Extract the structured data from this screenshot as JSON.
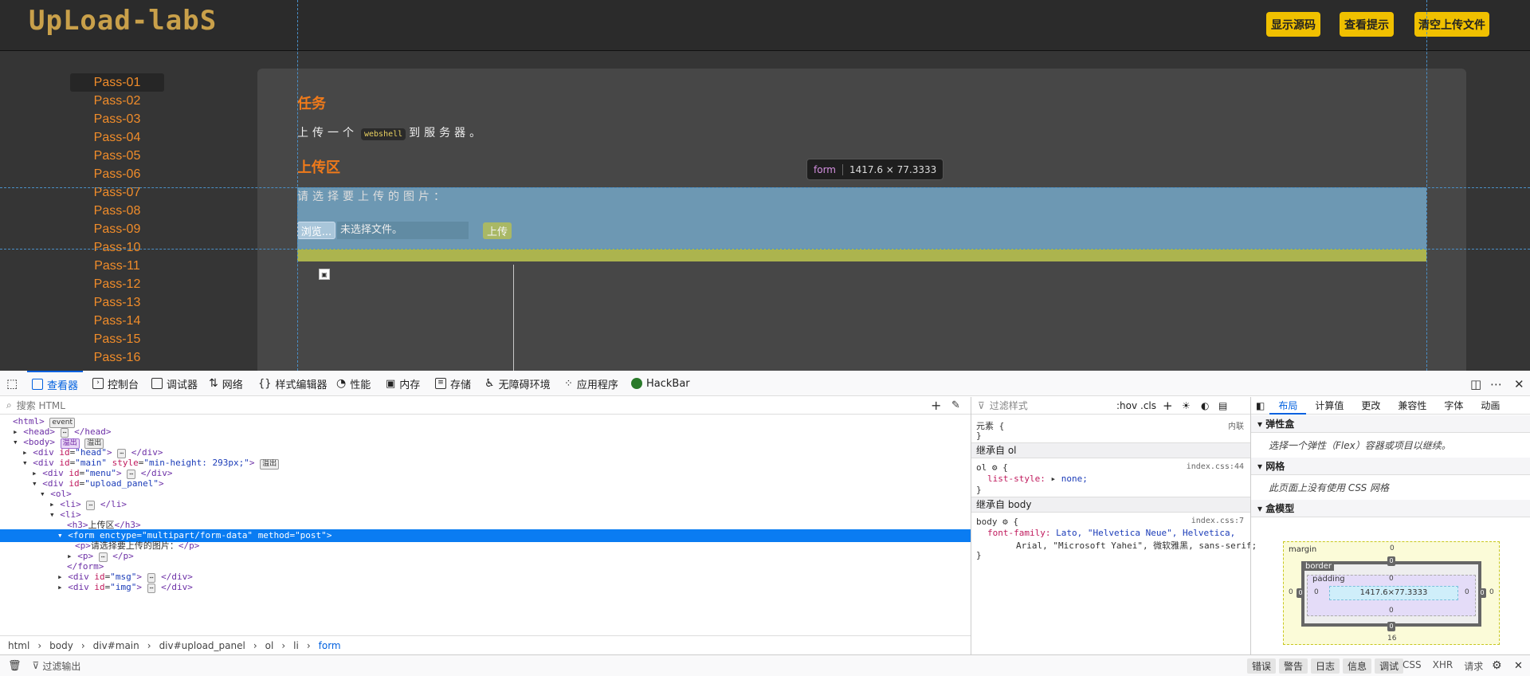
{
  "page": {
    "logo": "UpLoad-labS",
    "buttons": [
      "显示源码",
      "查看提示",
      "清空上传文件"
    ],
    "menu": [
      "Pass-01",
      "Pass-02",
      "Pass-03",
      "Pass-04",
      "Pass-05",
      "Pass-06",
      "Pass-07",
      "Pass-08",
      "Pass-09",
      "Pass-10",
      "Pass-11",
      "Pass-12",
      "Pass-13",
      "Pass-14",
      "Pass-15",
      "Pass-16"
    ],
    "task_heading": "任务",
    "task_text_before": "上传一个",
    "task_code": "webshell",
    "task_text_after": "到服务器。",
    "upload_heading": "上传区",
    "upload_label": "请选择要上传的图片：",
    "browse_label": "浏览...",
    "no_file": "未选择文件。",
    "upload_button": "上传"
  },
  "inspector_tooltip": {
    "tag": "form",
    "size": "1417.6 × 77.3333"
  },
  "devtools": {
    "tabs": [
      "查看器",
      "控制台",
      "调试器",
      "网络",
      "样式编辑器",
      "性能",
      "内存",
      "存储",
      "无障碍环境",
      "应用程序",
      "HackBar"
    ],
    "search_placeholder": "搜索 HTML",
    "breadcrumb": [
      "html",
      "body",
      "div#main",
      "div#upload_panel",
      "ol",
      "li",
      "form"
    ],
    "filter_output_placeholder": "过滤输出",
    "console_filters": [
      "错误",
      "警告",
      "日志",
      "信息",
      "调试"
    ],
    "console_net": [
      "CSS",
      "XHR",
      "请求"
    ],
    "rules": {
      "filter_placeholder": "过滤样式",
      "hov": ":hov",
      "cls": ".cls",
      "element_label": "元素 {",
      "element_close": "}",
      "inline": "内联",
      "inherit_ol": "继承自 ol",
      "ol_selector": "ol",
      "ol_prop": "list-style: ",
      "ol_val": "none;",
      "ol_src": "index.css:44",
      "inherit_body": "继承自 body",
      "body_selector": "body",
      "body_prop": "font-family: ",
      "body_val1": "Lato, \"Helvetica Neue\", Helvetica,",
      "body_val2": "Arial, \"Microsoft Yahei\", 微软雅黑, sans-serif;",
      "body_src": "index.css:7"
    },
    "layout": {
      "tabs": [
        "布局",
        "计算值",
        "更改",
        "兼容性",
        "字体",
        "动画"
      ],
      "flex_heading": "弹性盒",
      "flex_note": "选择一个弹性（Flex）容器或项目以继续。",
      "grid_heading": "网格",
      "grid_note": "此页面上没有使用 CSS 网格",
      "boxmodel_heading": "盒模型",
      "margin_label": "margin",
      "border_label": "border",
      "padding_label": "padding",
      "content_size": "1417.6×77.3333",
      "zero": "0",
      "margin_bottom": "16"
    }
  }
}
